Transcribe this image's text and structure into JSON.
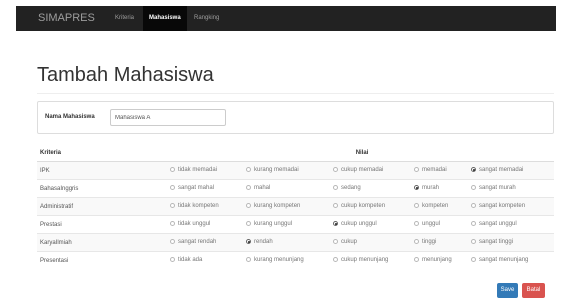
{
  "navbar": {
    "brand": "SIMAPRES",
    "items": [
      {
        "label": "Kriteria",
        "active": false
      },
      {
        "label": "Mahasiswa",
        "active": true
      },
      {
        "label": "Rangking",
        "active": false
      }
    ]
  },
  "page": {
    "title": "Tambah Mahasiswa"
  },
  "form": {
    "name_label": "Nama Mahasiswa",
    "name_value": "Mahasiswa A"
  },
  "table": {
    "headers": [
      "Kriteria",
      "Nilai"
    ],
    "rows": [
      {
        "criterion": "IPK",
        "options": [
          "tidak memadai",
          "kurang memadai",
          "cukup memadai",
          "memadai",
          "sangat memadai"
        ],
        "selected": 4
      },
      {
        "criterion": "BahasaInggris",
        "options": [
          "sangat mahal",
          "mahal",
          "sedang",
          "murah",
          "sangat murah"
        ],
        "selected": 3
      },
      {
        "criterion": "Administratif",
        "options": [
          "tidak kompeten",
          "kurang kompeten",
          "cukup kompeten",
          "kompeten",
          "sangat kompeten"
        ],
        "selected": null
      },
      {
        "criterion": "Prestasi",
        "options": [
          "tidak unggul",
          "kurang unggul",
          "cukup unggul",
          "unggul",
          "sangat unggul"
        ],
        "selected": 2
      },
      {
        "criterion": "KaryaIlmiah",
        "options": [
          "sangat rendah",
          "rendah",
          "cukup",
          "tinggi",
          "sangat tinggi"
        ],
        "selected": 1
      },
      {
        "criterion": "Presentasi",
        "options": [
          "tidak ada",
          "kurang menunjang",
          "cukup menunjang",
          "menunjang",
          "sangat menunjang"
        ],
        "selected": null
      }
    ]
  },
  "actions": {
    "save_label": "Save",
    "cancel_label": "Batal"
  },
  "colors": {
    "navbar": "#222222",
    "primary": "#337ab7",
    "danger": "#d9534f"
  }
}
